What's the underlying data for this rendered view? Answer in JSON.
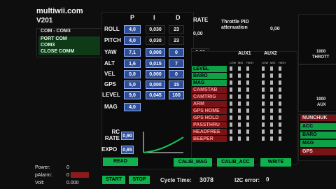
{
  "app": {
    "name": "multiwii.com",
    "version": "V201"
  },
  "serial": {
    "items": [
      "COM - COM3",
      "PORT COM",
      "COM3",
      "CLOSE COMM"
    ]
  },
  "pid_headers": [
    "P",
    "I",
    "D",
    "RATE"
  ],
  "pid_rows": [
    {
      "label": "ROLL",
      "p": "4,0",
      "i": "0,030",
      "d": "23",
      "rate": "0,00"
    },
    {
      "label": "PITCH",
      "p": "4,0",
      "i": "0,030",
      "d": "23",
      "rate": ""
    },
    {
      "label": "YAW",
      "p": "7,1",
      "i": "0,000",
      "d": "0",
      "rate": "0,00"
    },
    {
      "label": "ALT",
      "p": "1,6",
      "i": "0,015",
      "d": "7",
      "rate": ""
    },
    {
      "label": "VEL",
      "p": "0,0",
      "i": "0,000",
      "d": "0",
      "rate": ""
    },
    {
      "label": "GPS",
      "p": "5,0",
      "i": "0,000",
      "d": "15",
      "rate": ""
    },
    {
      "label": "LEVEL",
      "p": "9,0",
      "i": "0,045",
      "d": "100",
      "rate": ""
    },
    {
      "label": "MAG",
      "p": "4,0",
      "i": "",
      "d": "",
      "rate": ""
    }
  ],
  "throttle": {
    "label": "Throttle PID attenuation",
    "value": "0,00"
  },
  "rc": {
    "rate_label": "RC RATE",
    "rate_value": "0,90",
    "expo_label": "EXPO",
    "expo_value": "0,65"
  },
  "aux": {
    "aux1": "AUX1",
    "aux2": "AUX2",
    "subheaders": [
      "LOW",
      "MID",
      "HIGH"
    ]
  },
  "modes": [
    {
      "name": "LEVEL",
      "active": true
    },
    {
      "name": "BARO",
      "active": true
    },
    {
      "name": "MAG",
      "active": true
    },
    {
      "name": "CAMSTAB",
      "active": false
    },
    {
      "name": "CAMTRIG",
      "active": false
    },
    {
      "name": "ARM",
      "active": false
    },
    {
      "name": "GPS HOME",
      "active": false
    },
    {
      "name": "GPS HOLD",
      "active": false
    },
    {
      "name": "PASSTHRU",
      "active": false
    },
    {
      "name": "HEADFREE",
      "active": false
    },
    {
      "name": "BEEPER",
      "active": false
    }
  ],
  "right_panel": {
    "throt_value": "1000",
    "throt_label": "THROTT",
    "aux_value": "1000",
    "aux_label": "AUX",
    "items": [
      "NUNCHUK",
      "ACC",
      "BARO",
      "MAG",
      "GPS"
    ]
  },
  "bottom": {
    "read": "READ",
    "calib_mag": "CALIB_MAG",
    "calib_acc": "CALIB_ACC",
    "write": "WRITE",
    "start": "START",
    "stop": "STOP",
    "cycle_time_label": "Cycle Time:",
    "cycle_time_value": "3078",
    "i2c_label": "I2C error:",
    "i2c_value": "0",
    "power_label": "Power:",
    "power_value": "0",
    "palarm_label": "pAlarm:",
    "palarm_value": "0",
    "volt_label": "Volt:",
    "volt_value": "0.000"
  },
  "colors": {
    "green": "#10a046",
    "blue": "#2f4f99",
    "red": "#7b1316",
    "bg": "#0e0e0e"
  }
}
